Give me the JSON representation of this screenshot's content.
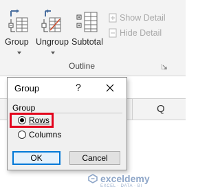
{
  "ribbon": {
    "buttons": [
      {
        "label": "Group",
        "icon": "group-icon"
      },
      {
        "label": "Ungroup",
        "icon": "ungroup-icon"
      },
      {
        "label": "Subtotal",
        "icon": "subtotal-icon"
      }
    ],
    "small_commands": [
      {
        "label": "Show Detail",
        "icon": "show-detail-icon"
      },
      {
        "label": "Hide Detail",
        "icon": "hide-detail-icon"
      }
    ],
    "group_caption": "Outline"
  },
  "sheet": {
    "column_header": "Q"
  },
  "dialog": {
    "title": "Group",
    "help": "?",
    "section_label": "Group",
    "options": [
      {
        "label": "Rows",
        "checked": true
      },
      {
        "label": "Columns",
        "checked": false
      }
    ],
    "ok_label": "OK",
    "cancel_label": "Cancel"
  },
  "watermark": {
    "brand": "exceldemy",
    "tagline": "EXCEL · DATA · BI"
  },
  "colors": {
    "highlight": "#e3001b",
    "accent": "#0078d7"
  }
}
